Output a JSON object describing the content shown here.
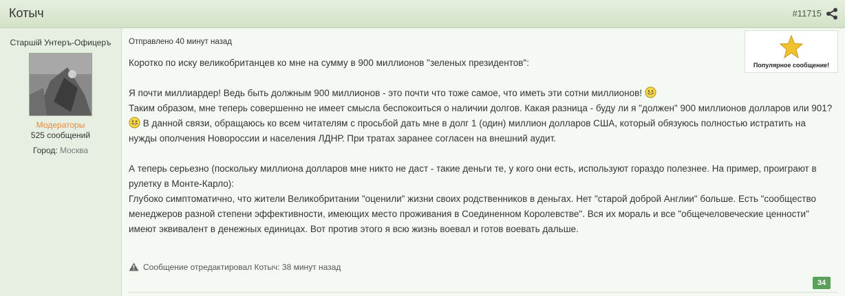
{
  "post": {
    "author": "Котыч",
    "number": "#11715",
    "posted_time": "Отправлено 40 минут назад",
    "popular_label": "Популярное сообщение!",
    "edited_note": "Сообщение отредактировал Котыч: 38 минут назад",
    "likes": "34",
    "body": {
      "p1": "Коротко по иску великобританцев ко мне на сумму в 900 миллионов \"зеленых президентов\":",
      "p2a": "Я почти миллиардер! Ведь быть должным 900 миллионов - это почти что тоже самое, что иметь эти сотни миллионов! ",
      "p2b1": "Таким образом, мне теперь совершенно не имеет смысла беспокоиться о наличии долгов. Какая разница - буду ли я \"должен\" 900 миллионов долларов или 901? ",
      "p2b2": " В данной связи, обращаюсь ко всем читателям с просьбой дать мне в долг 1 (один) миллион долларов США, который обязуюсь полностью истратить на нужды ополчения Новороссии и населения ЛДНР. При тратах заранее согласен на внешний аудит.",
      "p3": "А теперь серьезно (поскольку миллиона долларов мне никто не даст - такие деньги те, у кого они есть, используют гораздо полезнее. На пример, проиграют  в рулетку в Монте-Карло):",
      "p4": "Глубоко симптоматично, что жители Великобритании \"оценили\" жизни своих родственников в деньгах. Нет \"старой доброй Англии\" больше. Есть \"сообщество менеджеров разной степени эффективности, имеющих место проживания в Соединенном Королевстве\". Вся их мораль и все \"общечеловеческие ценности\"  имеют эквивалент в денежных единицах. Вот против этого я всю жизнь воевал и готов воевать дальше."
    }
  },
  "author_info": {
    "rank": "Старшій Унтеръ-Офицеръ",
    "group": "Модераторы",
    "message_count": "525 сообщений",
    "city_label": "Город:",
    "city_value": "Москва"
  },
  "colors": {
    "header": "#d4e2c8",
    "group": "#e8883c",
    "like_badge": "#5aa25a"
  },
  "icons": [
    "share-icon",
    "star-icon",
    "smiley-icon",
    "warning-icon"
  ]
}
